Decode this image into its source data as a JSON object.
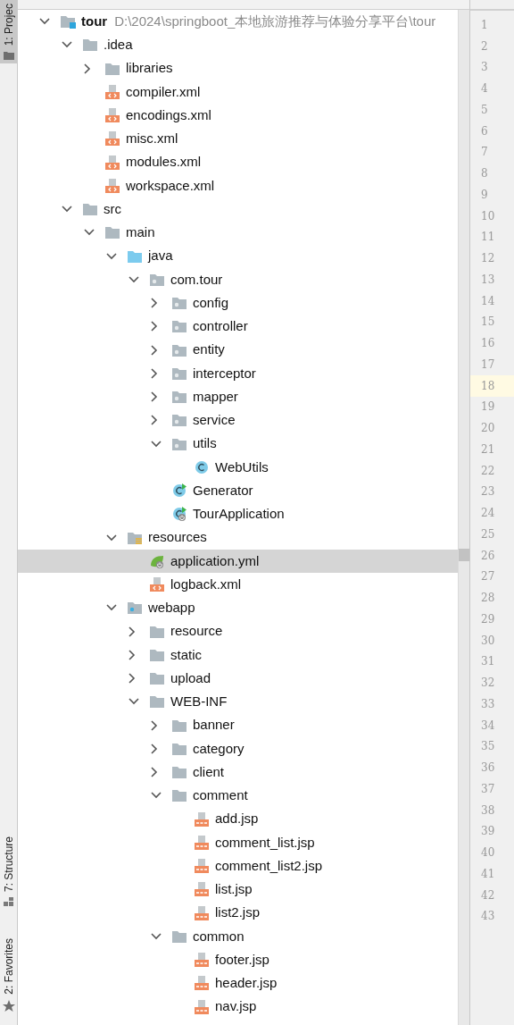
{
  "tool_windows": [
    {
      "label": "1: Projec",
      "kind": "project",
      "selected": true
    },
    {
      "label": "7: Structure",
      "kind": "structure",
      "selected": false
    },
    {
      "label": "2: Favorites",
      "kind": "favorites",
      "selected": false
    }
  ],
  "tree": [
    {
      "name": "tour",
      "path": "D:\\2024\\springboot_本地旅游推荐与体验分享平台\\tour",
      "kind": "module",
      "expanded": true,
      "selected": false,
      "children": [
        {
          "name": ".idea",
          "kind": "folder",
          "expanded": true,
          "selected": false,
          "children": [
            {
              "name": "libraries",
              "kind": "folder",
              "expanded": false,
              "selected": false
            },
            {
              "name": "compiler.xml",
              "kind": "xml",
              "selected": false
            },
            {
              "name": "encodings.xml",
              "kind": "xml",
              "selected": false
            },
            {
              "name": "misc.xml",
              "kind": "xml",
              "selected": false
            },
            {
              "name": "modules.xml",
              "kind": "xml",
              "selected": false
            },
            {
              "name": "workspace.xml",
              "kind": "xml",
              "selected": false
            }
          ]
        },
        {
          "name": "src",
          "kind": "folder",
          "expanded": true,
          "selected": false,
          "children": [
            {
              "name": "main",
              "kind": "folder",
              "expanded": true,
              "selected": false,
              "children": [
                {
                  "name": "java",
                  "kind": "source",
                  "expanded": true,
                  "selected": false,
                  "children": [
                    {
                      "name": "com.tour",
                      "kind": "package",
                      "expanded": true,
                      "selected": false,
                      "children": [
                        {
                          "name": "config",
                          "kind": "package",
                          "expanded": false,
                          "selected": false
                        },
                        {
                          "name": "controller",
                          "kind": "package",
                          "expanded": false,
                          "selected": false
                        },
                        {
                          "name": "entity",
                          "kind": "package",
                          "expanded": false,
                          "selected": false
                        },
                        {
                          "name": "interceptor",
                          "kind": "package",
                          "expanded": false,
                          "selected": false
                        },
                        {
                          "name": "mapper",
                          "kind": "package",
                          "expanded": false,
                          "selected": false
                        },
                        {
                          "name": "service",
                          "kind": "package",
                          "expanded": false,
                          "selected": false
                        },
                        {
                          "name": "utils",
                          "kind": "package",
                          "expanded": true,
                          "selected": false,
                          "children": [
                            {
                              "name": "WebUtils",
                              "kind": "class",
                              "selected": false
                            }
                          ]
                        },
                        {
                          "name": "Generator",
                          "kind": "runnable",
                          "selected": false
                        },
                        {
                          "name": "TourApplication",
                          "kind": "spring-app",
                          "selected": false
                        }
                      ]
                    }
                  ]
                },
                {
                  "name": "resources",
                  "kind": "resources",
                  "expanded": true,
                  "selected": false,
                  "children": [
                    {
                      "name": "application.yml",
                      "kind": "spring-yml",
                      "selected": true
                    },
                    {
                      "name": "logback.xml",
                      "kind": "xml",
                      "selected": false
                    }
                  ]
                },
                {
                  "name": "webapp",
                  "kind": "web",
                  "expanded": true,
                  "selected": false,
                  "children": [
                    {
                      "name": "resource",
                      "kind": "folder",
                      "expanded": false,
                      "selected": false
                    },
                    {
                      "name": "static",
                      "kind": "folder",
                      "expanded": false,
                      "selected": false
                    },
                    {
                      "name": "upload",
                      "kind": "folder",
                      "expanded": false,
                      "selected": false
                    },
                    {
                      "name": "WEB-INF",
                      "kind": "folder",
                      "expanded": true,
                      "selected": false,
                      "children": [
                        {
                          "name": "banner",
                          "kind": "folder",
                          "expanded": false,
                          "selected": false
                        },
                        {
                          "name": "category",
                          "kind": "folder",
                          "expanded": false,
                          "selected": false
                        },
                        {
                          "name": "client",
                          "kind": "folder",
                          "expanded": false,
                          "selected": false
                        },
                        {
                          "name": "comment",
                          "kind": "folder",
                          "expanded": true,
                          "selected": false,
                          "children": [
                            {
                              "name": "add.jsp",
                              "kind": "jsp",
                              "selected": false
                            },
                            {
                              "name": "comment_list.jsp",
                              "kind": "jsp",
                              "selected": false
                            },
                            {
                              "name": "comment_list2.jsp",
                              "kind": "jsp",
                              "selected": false
                            },
                            {
                              "name": "list.jsp",
                              "kind": "jsp",
                              "selected": false
                            },
                            {
                              "name": "list2.jsp",
                              "kind": "jsp",
                              "selected": false
                            }
                          ]
                        },
                        {
                          "name": "common",
                          "kind": "folder",
                          "expanded": true,
                          "selected": false,
                          "children": [
                            {
                              "name": "footer.jsp",
                              "kind": "jsp",
                              "selected": false
                            },
                            {
                              "name": "header.jsp",
                              "kind": "jsp",
                              "selected": false
                            },
                            {
                              "name": "nav.jsp",
                              "kind": "jsp",
                              "selected": false
                            }
                          ]
                        }
                      ]
                    }
                  ]
                }
              ]
            }
          ]
        }
      ]
    }
  ],
  "gutter": [
    {
      "number": "1",
      "current": false
    },
    {
      "number": "2",
      "current": false
    },
    {
      "number": "3",
      "current": false
    },
    {
      "number": "4",
      "current": false
    },
    {
      "number": "5",
      "current": false
    },
    {
      "number": "6",
      "current": false
    },
    {
      "number": "7",
      "current": false
    },
    {
      "number": "8",
      "current": false
    },
    {
      "number": "9",
      "current": false
    },
    {
      "number": "10",
      "current": false
    },
    {
      "number": "11",
      "current": false
    },
    {
      "number": "12",
      "current": false
    },
    {
      "number": "13",
      "current": false
    },
    {
      "number": "14",
      "current": false
    },
    {
      "number": "15",
      "current": false
    },
    {
      "number": "16",
      "current": false
    },
    {
      "number": "17",
      "current": false
    },
    {
      "number": "18",
      "current": true
    },
    {
      "number": "19",
      "current": false
    },
    {
      "number": "20",
      "current": false
    },
    {
      "number": "21",
      "current": false
    },
    {
      "number": "22",
      "current": false
    },
    {
      "number": "23",
      "current": false
    },
    {
      "number": "24",
      "current": false
    },
    {
      "number": "25",
      "current": false
    },
    {
      "number": "26",
      "current": false
    },
    {
      "number": "27",
      "current": false
    },
    {
      "number": "28",
      "current": false
    },
    {
      "number": "29",
      "current": false
    },
    {
      "number": "30",
      "current": false
    },
    {
      "number": "31",
      "current": false
    },
    {
      "number": "32",
      "current": false
    },
    {
      "number": "33",
      "current": false
    },
    {
      "number": "34",
      "current": false
    },
    {
      "number": "35",
      "current": false
    },
    {
      "number": "36",
      "current": false
    },
    {
      "number": "37",
      "current": false
    },
    {
      "number": "38",
      "current": false
    },
    {
      "number": "39",
      "current": false
    },
    {
      "number": "40",
      "current": false
    },
    {
      "number": "41",
      "current": false
    },
    {
      "number": "42",
      "current": false
    },
    {
      "number": "43",
      "current": false
    }
  ]
}
